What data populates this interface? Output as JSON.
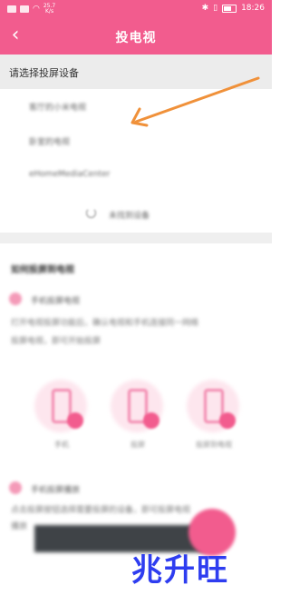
{
  "status_bar": {
    "network_speed_value": "25.7",
    "network_speed_unit": "K/s",
    "time": "18:26"
  },
  "app_bar": {
    "back_glyph": "‹",
    "title": "投电视"
  },
  "devices_section": {
    "header": "请选择投屏设备",
    "devices": [
      {
        "name": "客厅的小米电视"
      },
      {
        "name": "卧室的电视"
      },
      {
        "name": "eHomeMediaCenter"
      }
    ],
    "refresh_label": "未找到设备"
  },
  "help_section": {
    "title": "如何投屏到电视",
    "step1_title": "手机投屏电视",
    "step1_desc_line1": "打开电视投屏功能后，确认电视和手机连接同一网络",
    "step1_desc_line2": "投屏电视，即可开始投屏",
    "captions": [
      "手机",
      "投屏",
      "投屏到电视"
    ],
    "step2_title": "手机投屏播放",
    "step2_desc_line1": "点击投屏按钮选择需要投屏的设备，即可投屏电视",
    "step2_desc_line2": "播放"
  },
  "watermark": "兆升旺",
  "colors": {
    "accent": "#f25c8e",
    "arrow": "#f0913a",
    "watermark": "#2e3df0"
  }
}
